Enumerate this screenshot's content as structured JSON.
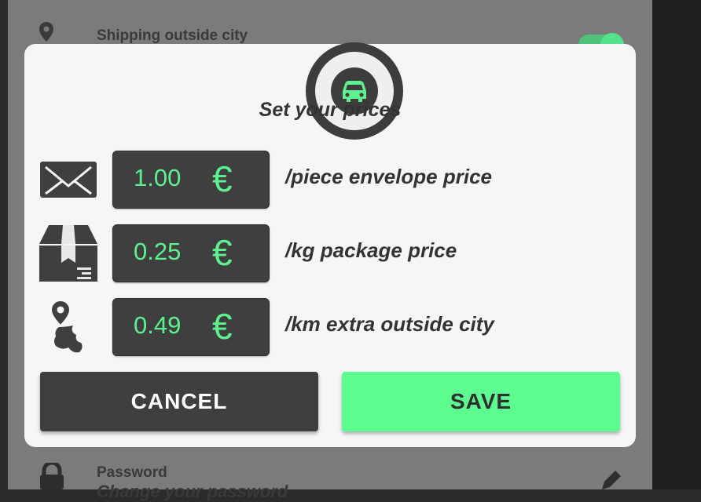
{
  "background": {
    "shipping_label": "Shipping outside city",
    "password_label": "Password",
    "password_sub": "Change your password"
  },
  "dialog": {
    "title": "Set your prices",
    "badge_icon": "car-icon",
    "rows": [
      {
        "icon": "envelope-icon",
        "value": "1.00",
        "currency": "€",
        "label": "/piece envelope price"
      },
      {
        "icon": "package-icon",
        "value": "0.25",
        "currency": "€",
        "label": "/kg package price"
      },
      {
        "icon": "map-pin-icon",
        "value": "0.49",
        "currency": "€",
        "label": "/km extra outside city"
      }
    ],
    "cancel_label": "CANCEL",
    "save_label": "SAVE"
  },
  "colors": {
    "accent": "#5cff8f",
    "dark": "#3f3f3f",
    "dialog_bg": "#f6f6f6"
  }
}
